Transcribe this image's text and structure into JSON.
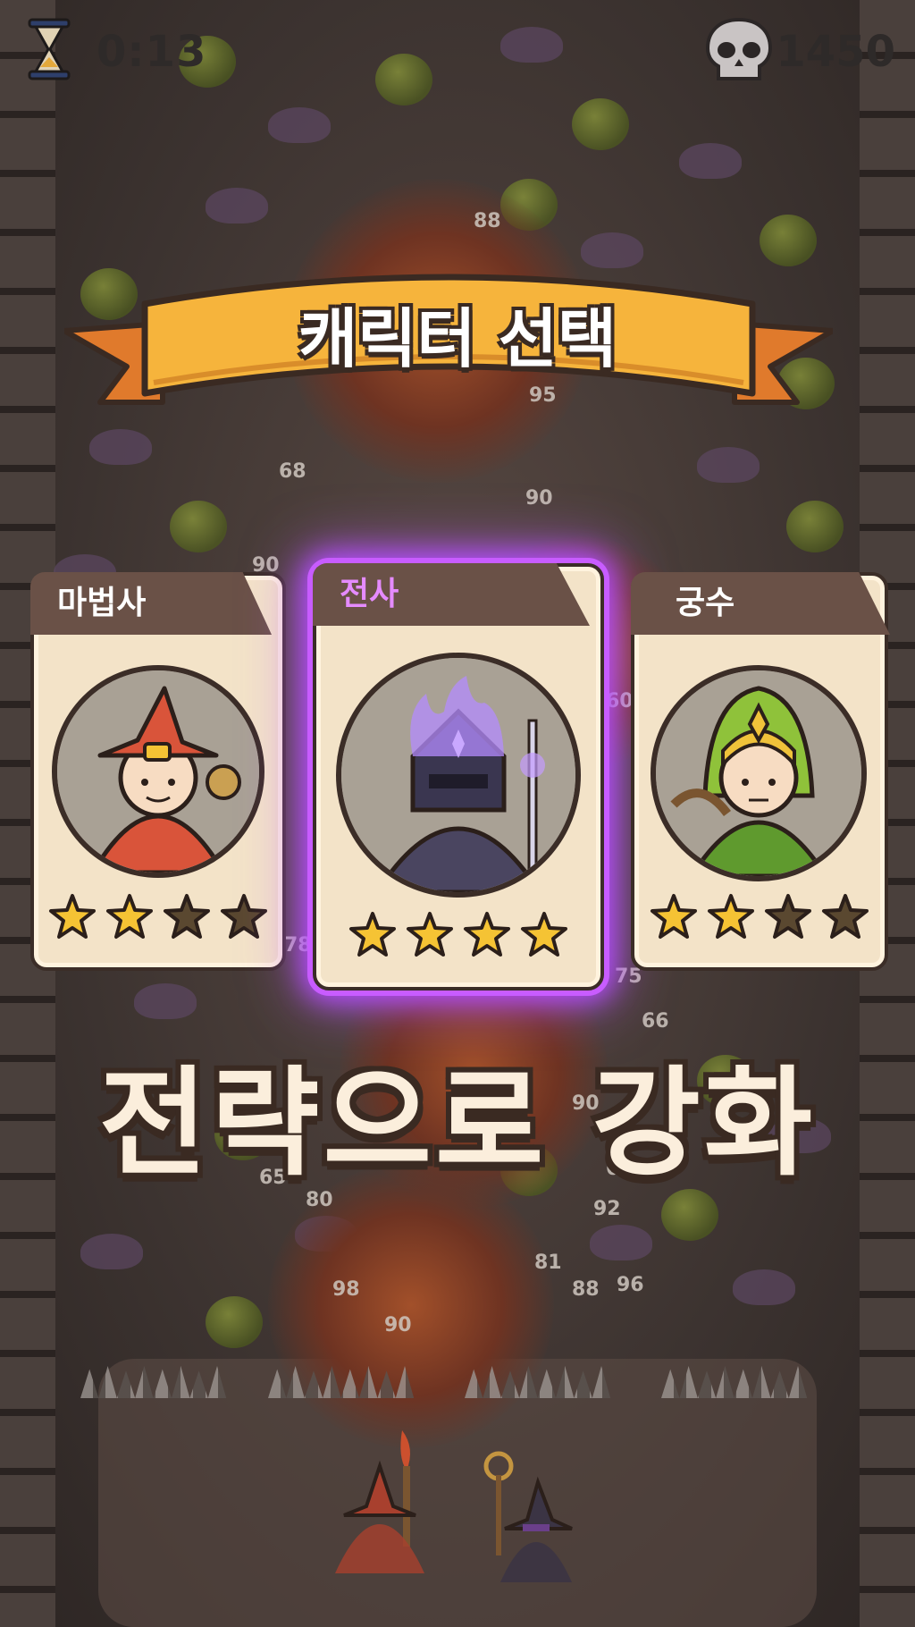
{
  "hud": {
    "timer": "0:13",
    "score": "1450",
    "hourglass_icon": "hourglass-icon",
    "skull_icon": "skull-icon"
  },
  "banner": {
    "title": "캐릭터 선택"
  },
  "cards": [
    {
      "name": "마법사",
      "stars_filled": 2,
      "stars_total": 4,
      "selected": false,
      "icon": "wizard-portrait"
    },
    {
      "name": "전사",
      "stars_filled": 4,
      "stars_total": 4,
      "selected": true,
      "icon": "dark-knight-portrait"
    },
    {
      "name": "궁수",
      "stars_filled": 2,
      "stars_total": 4,
      "selected": false,
      "icon": "archer-portrait"
    }
  ],
  "tagline": "전략으로 강화",
  "damage_numbers": [
    "88",
    "95",
    "68",
    "90",
    "90",
    "60",
    "78",
    "75",
    "66",
    "90",
    "61",
    "65",
    "80",
    "92",
    "81",
    "96",
    "98",
    "88",
    "90"
  ],
  "colors": {
    "banner_gold": "#f6b43c",
    "banner_orange": "#e07a2c",
    "selected_glow": "#b44bff",
    "star_gold": "#f5c334",
    "star_empty": "#5a4830"
  }
}
